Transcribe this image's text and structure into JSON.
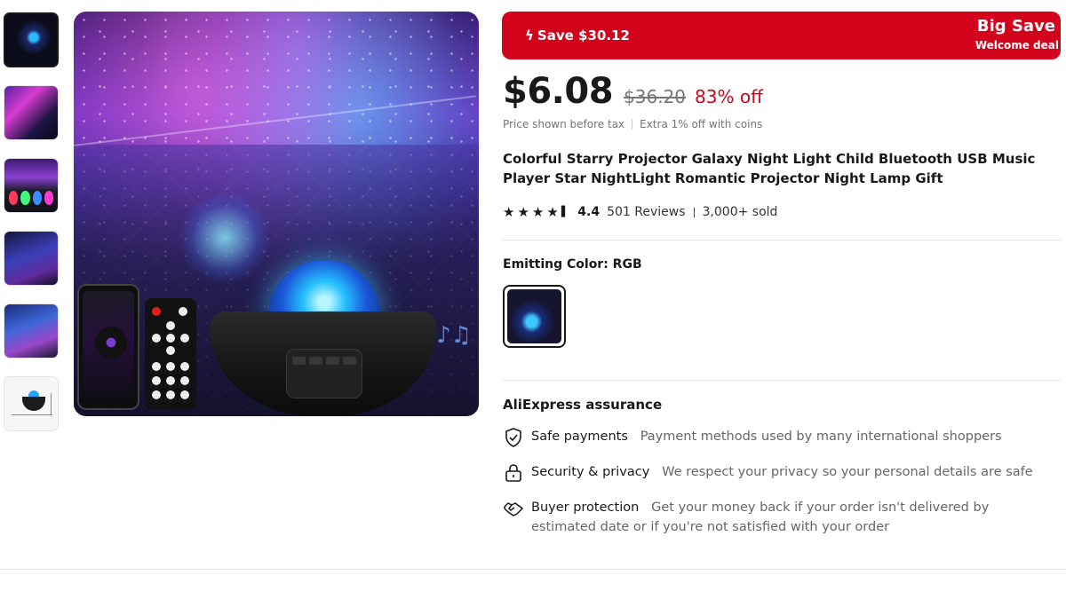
{
  "banner": {
    "save_text": "Save $30.12",
    "big_text": "Big Save",
    "welcome_text": "Welcome deal"
  },
  "price": {
    "current": "$6.08",
    "original": "$36.20",
    "discount": "83% off",
    "tax_note": "Price shown before tax",
    "coins_note": "Extra 1% off with coins"
  },
  "product": {
    "title": "Colorful Starry Projector Galaxy Night Light Child Bluetooth USB Music Player Star NightLight Romantic Projector Night Lamp Gift"
  },
  "rating": {
    "score": "4.4",
    "reviews": "501 Reviews",
    "sold": "3,000+ sold",
    "stars": 4.4
  },
  "variant": {
    "label": "Emitting Color: RGB"
  },
  "assurance": {
    "title": "AliExpress assurance",
    "items": [
      {
        "label": "Safe payments",
        "desc": "Payment methods used by many international shoppers",
        "icon": "shield-check-icon"
      },
      {
        "label": "Security & privacy",
        "desc": "We respect your privacy so your personal details are safe",
        "icon": "lock-icon"
      },
      {
        "label": "Buyer protection",
        "desc": "Get your money back if your order isn't delivered by estimated date or if you're not satisfied with your order",
        "icon": "handshake-icon"
      }
    ]
  },
  "colors": {
    "accent_red": "#d3031c",
    "text_primary": "#191919",
    "text_muted": "#757575"
  }
}
